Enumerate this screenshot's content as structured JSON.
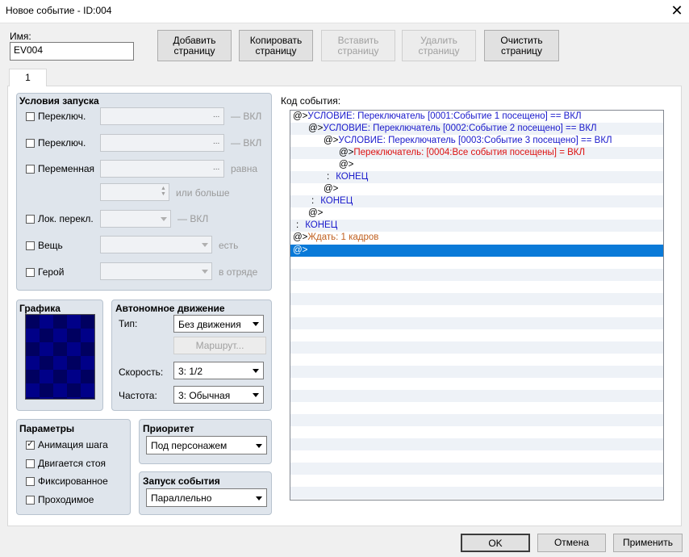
{
  "window": {
    "title": "Новое событие - ID:004"
  },
  "name": {
    "label": "Имя:",
    "value": "EV004"
  },
  "toolbar": {
    "add": "Добавить\nстраницу",
    "copy": "Копировать\nстраницу",
    "paste": "Вставить\nстраницу",
    "delete": "Удалить\nстраницу",
    "clear": "Очистить\nстраницу"
  },
  "tabs": [
    {
      "label": "1"
    }
  ],
  "conditions": {
    "title": "Условия запуска",
    "switch1": {
      "label": "Переключ.",
      "suffix": "— ВКЛ"
    },
    "switch2": {
      "label": "Переключ.",
      "suffix": "— ВКЛ"
    },
    "variable": {
      "label": "Переменная",
      "suffix": "равна",
      "or_more": "или больше"
    },
    "self_switch": {
      "label": "Лок. перекл.",
      "suffix": "— ВКЛ"
    },
    "item": {
      "label": "Вещь",
      "suffix": "есть"
    },
    "actor": {
      "label": "Герой",
      "suffix": "в отряде"
    },
    "dots": "..."
  },
  "graphics": {
    "title": "Графика"
  },
  "autonomous": {
    "title": "Автономное движение",
    "type_label": "Тип:",
    "type_value": "Без движения",
    "route_button": "Маршрут...",
    "speed_label": "Скорость:",
    "speed_value": "3: 1/2",
    "freq_label": "Частота:",
    "freq_value": "3: Обычная"
  },
  "options": {
    "title": "Параметры",
    "items": [
      {
        "label": "Анимация шага",
        "checked": true
      },
      {
        "label": "Двигается стоя",
        "checked": false
      },
      {
        "label": "Фиксированное",
        "checked": false
      },
      {
        "label": "Проходимое",
        "checked": false
      }
    ]
  },
  "priority": {
    "title": "Приоритет",
    "value": "Под персонажем"
  },
  "trigger": {
    "title": "Запуск события",
    "value": "Параллельно"
  },
  "code": {
    "label": "Код события:",
    "lines": [
      {
        "prefix": "@>",
        "text": "УСЛОВИЕ: Переключатель [0001:Событие 1 посещено] == ВКЛ"
      },
      {
        "prefix": "@>",
        "text": "УСЛОВИЕ: Переключатель [0002:Событие 2 посещено] == ВКЛ"
      },
      {
        "prefix": "@>",
        "text": "УСЛОВИЕ: Переключатель [0003:Событие 3 посещено] == ВКЛ"
      },
      {
        "prefix": "@>",
        "text": "Переключатель: [0004:Все события посещены] = ВКЛ"
      },
      {
        "prefix": "@>",
        "text": ""
      },
      {
        "prefix": ":",
        "text": "КОНЕЦ"
      },
      {
        "prefix": "@>",
        "text": ""
      },
      {
        "prefix": ":",
        "text": "КОНЕЦ"
      },
      {
        "prefix": "@>",
        "text": ""
      },
      {
        "prefix": ":",
        "text": "КОНЕЦ"
      },
      {
        "prefix": "@>",
        "text": "Ждать: 1 кадров"
      },
      {
        "prefix": "@>",
        "text": ""
      }
    ]
  },
  "footer": {
    "ok": "OK",
    "cancel": "Отмена",
    "apply": "Применить"
  }
}
